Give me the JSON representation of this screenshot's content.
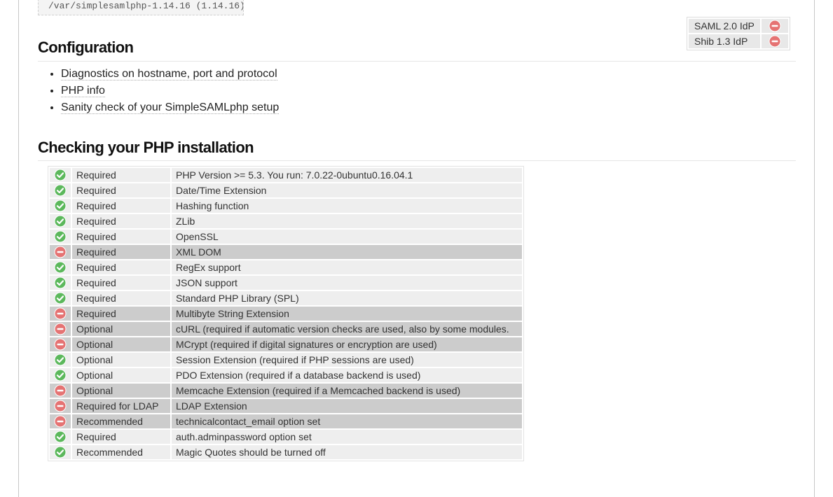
{
  "install_path": "/var/simplesamlphp-1.14.16 (1.14.16)",
  "metadata": [
    {
      "label": "SAML 2.0 IdP",
      "icon": "fail-icon"
    },
    {
      "label": "Shib 1.3 IdP",
      "icon": "fail-icon"
    }
  ],
  "configuration": {
    "heading": "Configuration",
    "links": [
      "Diagnostics on hostname, port and protocol",
      "PHP info",
      "Sanity check of your SimpleSAMLphp setup"
    ]
  },
  "php_check": {
    "heading": "Checking your PHP installation",
    "colors": {
      "ok": "#5cb85c",
      "fail": "#e57373",
      "ok_row": "#eeeeee",
      "fail_row": "#cccccc"
    },
    "rows": [
      {
        "status": "ok",
        "level": "Required",
        "description": "PHP Version >= 5.3. You run: 7.0.22-0ubuntu0.16.04.1"
      },
      {
        "status": "ok",
        "level": "Required",
        "description": "Date/Time Extension"
      },
      {
        "status": "ok",
        "level": "Required",
        "description": "Hashing function"
      },
      {
        "status": "ok",
        "level": "Required",
        "description": "ZLib"
      },
      {
        "status": "ok",
        "level": "Required",
        "description": "OpenSSL"
      },
      {
        "status": "fail",
        "level": "Required",
        "description": "XML DOM"
      },
      {
        "status": "ok",
        "level": "Required",
        "description": "RegEx support"
      },
      {
        "status": "ok",
        "level": "Required",
        "description": "JSON support"
      },
      {
        "status": "ok",
        "level": "Required",
        "description": "Standard PHP Library (SPL)"
      },
      {
        "status": "fail",
        "level": "Required",
        "description": "Multibyte String Extension"
      },
      {
        "status": "fail",
        "level": "Optional",
        "description": "cURL (required if automatic version checks are used, also by some modules."
      },
      {
        "status": "fail",
        "level": "Optional",
        "description": "MCrypt (required if digital signatures or encryption are used)"
      },
      {
        "status": "ok",
        "level": "Optional",
        "description": "Session Extension (required if PHP sessions are used)"
      },
      {
        "status": "ok",
        "level": "Optional",
        "description": "PDO Extension (required if a database backend is used)"
      },
      {
        "status": "fail",
        "level": "Optional",
        "description": "Memcache Extension (required if a Memcached backend is used)"
      },
      {
        "status": "fail",
        "level": "Required for LDAP",
        "description": "LDAP Extension"
      },
      {
        "status": "fail",
        "level": "Recommended",
        "description": "technicalcontact_email option set"
      },
      {
        "status": "ok",
        "level": "Required",
        "description": "auth.adminpassword option set"
      },
      {
        "status": "ok",
        "level": "Recommended",
        "description": "Magic Quotes should be turned off"
      }
    ]
  }
}
